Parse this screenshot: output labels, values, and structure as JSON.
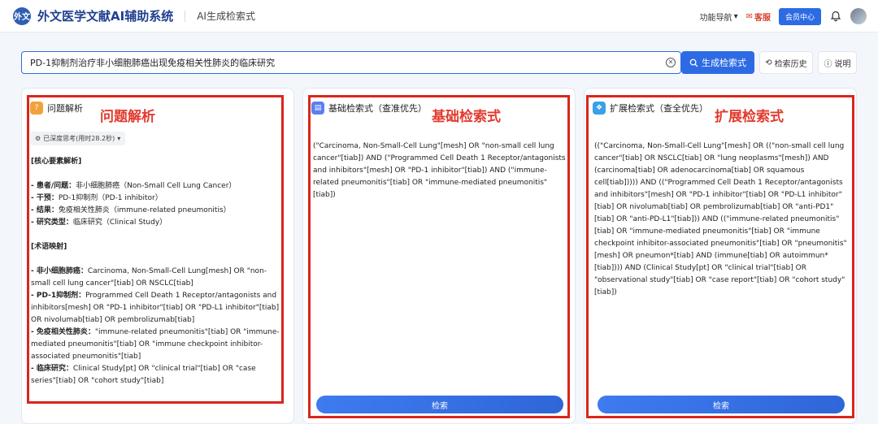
{
  "header": {
    "logo_text": "外文",
    "app_title": "外文医学文献AI辅助系统",
    "subtitle": "AI生成检索式",
    "nav_menu": "功能导航",
    "service": "客服",
    "member_center": "会员中心"
  },
  "search": {
    "value": "PD-1抑制剂治疗非小细胞肺癌出现免疫相关性肺炎的临床研究",
    "generate_label": "生成检索式",
    "history_label": "检索历史",
    "help_label": "说明"
  },
  "panel1": {
    "title": "问题解析",
    "annotation": "问题解析",
    "think_chip": "已深度思考(用时28.2秒)",
    "section_core": "[核心要素解析]",
    "core_items": [
      {
        "label": "- 患者/问题：",
        "text": "非小细胞肺癌（Non-Small Cell Lung Cancer）"
      },
      {
        "label": "- 干预：",
        "text": "PD-1抑制剂（PD-1 inhibitor）"
      },
      {
        "label": "- 结果：",
        "text": "免疫相关性肺炎（immune-related pneumonitis）"
      },
      {
        "label": "- 研究类型：",
        "text": "临床研究（Clinical Study）"
      }
    ],
    "section_terms": "[术语映射]",
    "term_items": [
      {
        "label": "- 非小细胞肺癌：",
        "text": "Carcinoma, Non-Small-Cell Lung[mesh] OR \"non-small cell lung cancer\"[tiab] OR NSCLC[tiab]"
      },
      {
        "label": "- PD-1抑制剂：",
        "text": "Programmed Cell Death 1 Receptor/antagonists and inhibitors[mesh] OR \"PD-1 inhibitor\"[tiab] OR \"PD-L1 inhibitor\"[tiab] OR nivolumab[tiab] OR pembrolizumab[tiab]"
      },
      {
        "label": "- 免疫相关性肺炎：",
        "text": "\"immune-related pneumonitis\"[tiab] OR \"immune-mediated pneumonitis\"[tiab] OR \"immune checkpoint inhibitor-associated pneumonitis\"[tiab]"
      },
      {
        "label": "- 临床研究：",
        "text": "Clinical Study[pt] OR \"clinical trial\"[tiab] OR \"case series\"[tiab] OR \"cohort study\"[tiab]"
      }
    ]
  },
  "panel2": {
    "title": "基础检索式（查准优先）",
    "annotation": "基础检索式",
    "query": "(\"Carcinoma, Non-Small-Cell Lung\"[mesh] OR \"non-small cell lung cancer\"[tiab]) AND (\"Programmed Cell Death 1 Receptor/antagonists and inhibitors\"[mesh] OR \"PD-1 inhibitor\"[tiab]) AND (\"immune-related pneumonitis\"[tiab] OR \"immune-mediated pneumonitis\"[tiab])",
    "search_label": "检索"
  },
  "panel3": {
    "title": "扩展检索式（查全优先）",
    "annotation": "扩展检索式",
    "query": "((\"Carcinoma, Non-Small-Cell Lung\"[mesh] OR ((\"non-small cell lung cancer\"[tiab] OR NSCLC[tiab] OR \"lung neoplasms\"[mesh]) AND (carcinoma[tiab] OR adenocarcinoma[tiab] OR squamous cell[tiab])))) AND ((\"Programmed Cell Death 1 Receptor/antagonists and inhibitors\"[mesh] OR \"PD-1 inhibitor\"[tiab] OR \"PD-L1 inhibitor\"[tiab] OR nivolumab[tiab] OR pembrolizumab[tiab] OR \"anti-PD1\"[tiab] OR \"anti-PD-L1\"[tiab])) AND ((\"immune-related pneumonitis\"[tiab] OR \"immune-mediated pneumonitis\"[tiab] OR \"immune checkpoint inhibitor-associated pneumonitis\"[tiab] OR \"pneumonitis\"[mesh] OR pneumon*[tiab] AND (immune[tiab] OR autoimmun*[tiab]))) AND (Clinical Study[pt] OR \"clinical trial\"[tiab] OR \"observational study\"[tiab] OR \"case report\"[tiab] OR \"cohort study\"[tiab])",
    "search_label": "检索"
  },
  "colors": {
    "primary": "#2d6be4",
    "annotation_red": "#e23a2e",
    "brand": "#1f3f8f"
  },
  "icons": [
    "logo-icon",
    "chevron-down-icon",
    "service-icon",
    "bell-icon",
    "avatar",
    "clear-icon",
    "search-icon",
    "history-icon",
    "help-icon",
    "question-icon",
    "basic-query-icon",
    "extended-query-icon",
    "brain-icon"
  ]
}
